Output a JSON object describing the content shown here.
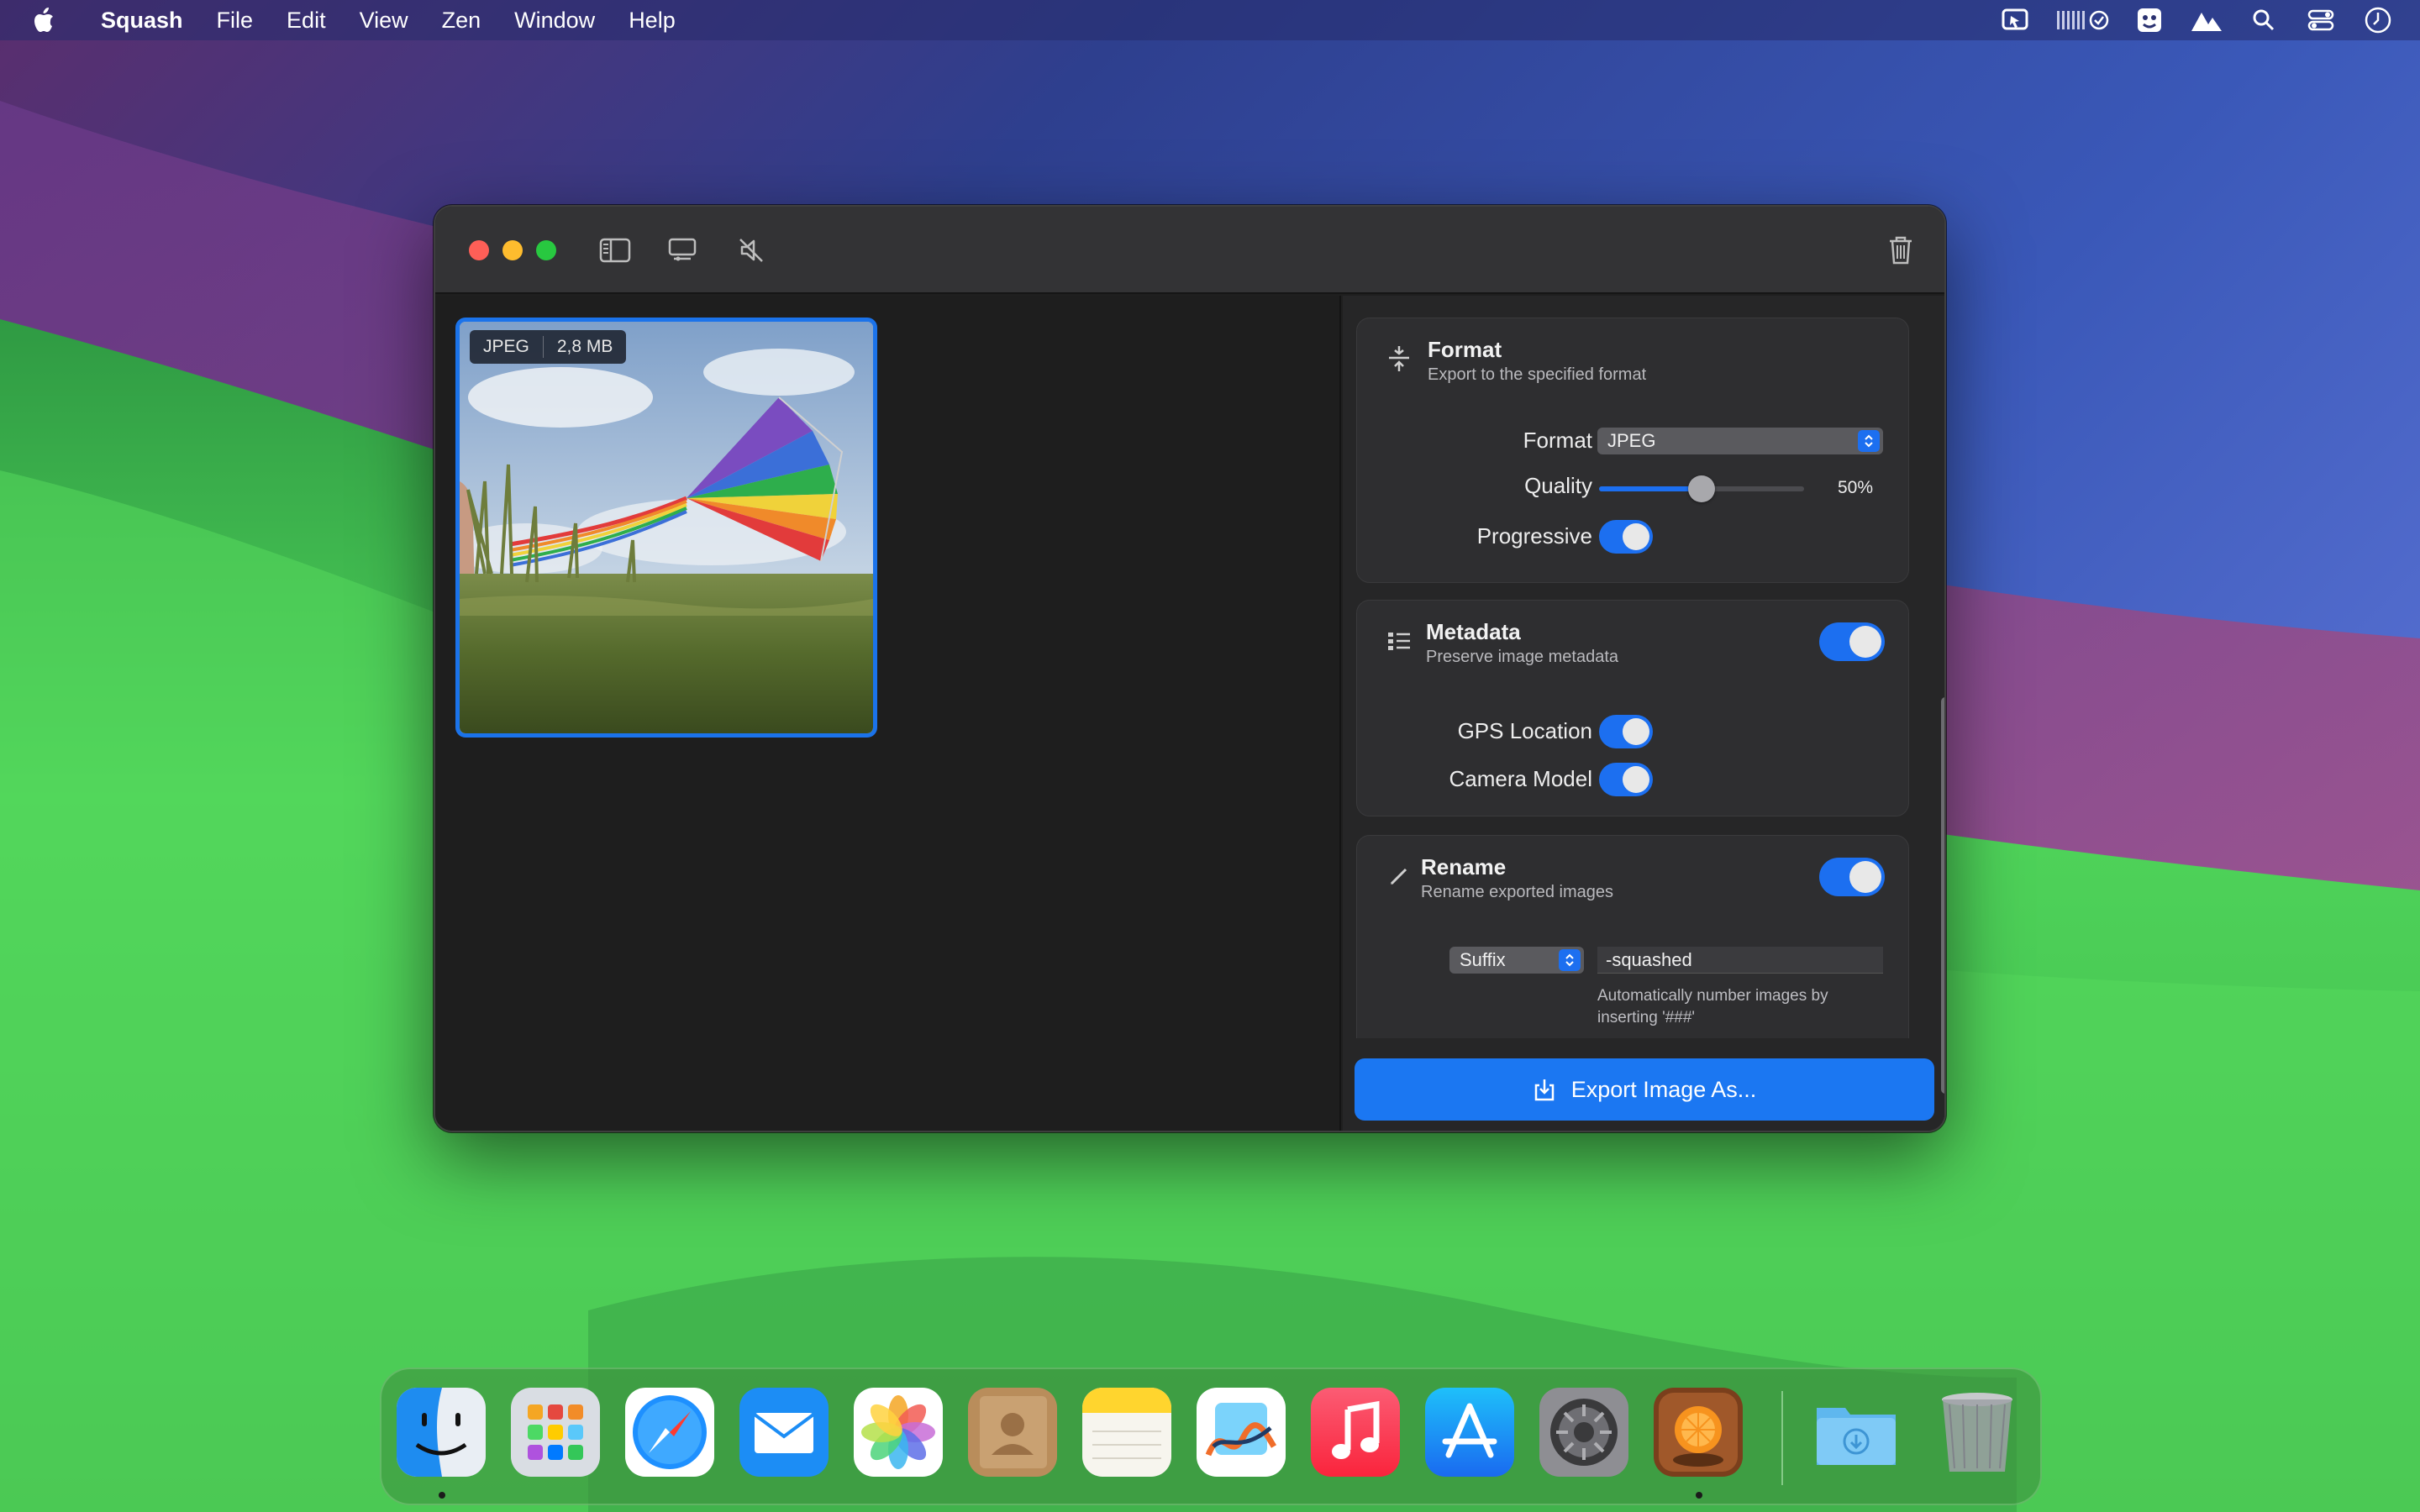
{
  "menubar": {
    "app_name": "Squash",
    "items": [
      "File",
      "Edit",
      "View",
      "Zen",
      "Window",
      "Help"
    ],
    "status_icons": [
      "status-app-icon",
      "battery-meter-icon",
      "menu-app-icon",
      "altitude-icon",
      "search-icon",
      "control-center-icon",
      "clock-icon"
    ]
  },
  "window": {
    "toolbar_icons": [
      "sidebar-icon",
      "display-icon",
      "mute-icon",
      "trash-icon"
    ],
    "thumbnail": {
      "format": "JPEG",
      "size": "2,8 MB"
    },
    "format_card": {
      "title": "Format",
      "subtitle": "Export to the specified format",
      "format_label": "Format",
      "format_value": "JPEG",
      "quality_label": "Quality",
      "quality_value": "50%",
      "quality_fraction": 0.5,
      "progressive_label": "Progressive",
      "progressive_on": true
    },
    "metadata_card": {
      "title": "Metadata",
      "subtitle": "Preserve image metadata",
      "enabled": true,
      "gps_label": "GPS Location",
      "gps_on": true,
      "camera_label": "Camera Model",
      "camera_on": true
    },
    "rename_card": {
      "title": "Rename",
      "subtitle": "Rename exported images",
      "enabled": true,
      "mode": "Suffix",
      "value": "-squashed",
      "hint": "Automatically number images by inserting '###'"
    },
    "export_button": "Export Image As..."
  },
  "dock": {
    "apps": [
      "Finder",
      "Launchpad",
      "Safari",
      "Mail",
      "Photos",
      "Contacts",
      "Notes",
      "Freeform",
      "Music",
      "App Store",
      "System Settings",
      "Squash",
      "Downloads",
      "Trash"
    ]
  },
  "colors": {
    "accent": "#1b77f2",
    "close": "#fe5f57",
    "minimize": "#febc2e",
    "maximize": "#28c840"
  }
}
